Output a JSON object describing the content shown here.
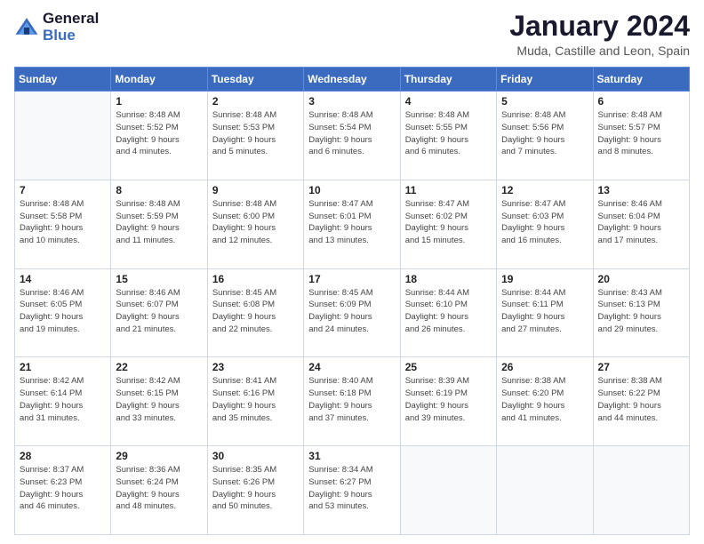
{
  "header": {
    "logo_line1": "General",
    "logo_line2": "Blue",
    "month_title": "January 2024",
    "location": "Muda, Castille and Leon, Spain"
  },
  "days_of_week": [
    "Sunday",
    "Monday",
    "Tuesday",
    "Wednesday",
    "Thursday",
    "Friday",
    "Saturday"
  ],
  "weeks": [
    [
      {
        "num": "",
        "detail": ""
      },
      {
        "num": "1",
        "detail": "Sunrise: 8:48 AM\nSunset: 5:52 PM\nDaylight: 9 hours\nand 4 minutes."
      },
      {
        "num": "2",
        "detail": "Sunrise: 8:48 AM\nSunset: 5:53 PM\nDaylight: 9 hours\nand 5 minutes."
      },
      {
        "num": "3",
        "detail": "Sunrise: 8:48 AM\nSunset: 5:54 PM\nDaylight: 9 hours\nand 6 minutes."
      },
      {
        "num": "4",
        "detail": "Sunrise: 8:48 AM\nSunset: 5:55 PM\nDaylight: 9 hours\nand 6 minutes."
      },
      {
        "num": "5",
        "detail": "Sunrise: 8:48 AM\nSunset: 5:56 PM\nDaylight: 9 hours\nand 7 minutes."
      },
      {
        "num": "6",
        "detail": "Sunrise: 8:48 AM\nSunset: 5:57 PM\nDaylight: 9 hours\nand 8 minutes."
      }
    ],
    [
      {
        "num": "7",
        "detail": "Sunrise: 8:48 AM\nSunset: 5:58 PM\nDaylight: 9 hours\nand 10 minutes."
      },
      {
        "num": "8",
        "detail": "Sunrise: 8:48 AM\nSunset: 5:59 PM\nDaylight: 9 hours\nand 11 minutes."
      },
      {
        "num": "9",
        "detail": "Sunrise: 8:48 AM\nSunset: 6:00 PM\nDaylight: 9 hours\nand 12 minutes."
      },
      {
        "num": "10",
        "detail": "Sunrise: 8:47 AM\nSunset: 6:01 PM\nDaylight: 9 hours\nand 13 minutes."
      },
      {
        "num": "11",
        "detail": "Sunrise: 8:47 AM\nSunset: 6:02 PM\nDaylight: 9 hours\nand 15 minutes."
      },
      {
        "num": "12",
        "detail": "Sunrise: 8:47 AM\nSunset: 6:03 PM\nDaylight: 9 hours\nand 16 minutes."
      },
      {
        "num": "13",
        "detail": "Sunrise: 8:46 AM\nSunset: 6:04 PM\nDaylight: 9 hours\nand 17 minutes."
      }
    ],
    [
      {
        "num": "14",
        "detail": "Sunrise: 8:46 AM\nSunset: 6:05 PM\nDaylight: 9 hours\nand 19 minutes."
      },
      {
        "num": "15",
        "detail": "Sunrise: 8:46 AM\nSunset: 6:07 PM\nDaylight: 9 hours\nand 21 minutes."
      },
      {
        "num": "16",
        "detail": "Sunrise: 8:45 AM\nSunset: 6:08 PM\nDaylight: 9 hours\nand 22 minutes."
      },
      {
        "num": "17",
        "detail": "Sunrise: 8:45 AM\nSunset: 6:09 PM\nDaylight: 9 hours\nand 24 minutes."
      },
      {
        "num": "18",
        "detail": "Sunrise: 8:44 AM\nSunset: 6:10 PM\nDaylight: 9 hours\nand 26 minutes."
      },
      {
        "num": "19",
        "detail": "Sunrise: 8:44 AM\nSunset: 6:11 PM\nDaylight: 9 hours\nand 27 minutes."
      },
      {
        "num": "20",
        "detail": "Sunrise: 8:43 AM\nSunset: 6:13 PM\nDaylight: 9 hours\nand 29 minutes."
      }
    ],
    [
      {
        "num": "21",
        "detail": "Sunrise: 8:42 AM\nSunset: 6:14 PM\nDaylight: 9 hours\nand 31 minutes."
      },
      {
        "num": "22",
        "detail": "Sunrise: 8:42 AM\nSunset: 6:15 PM\nDaylight: 9 hours\nand 33 minutes."
      },
      {
        "num": "23",
        "detail": "Sunrise: 8:41 AM\nSunset: 6:16 PM\nDaylight: 9 hours\nand 35 minutes."
      },
      {
        "num": "24",
        "detail": "Sunrise: 8:40 AM\nSunset: 6:18 PM\nDaylight: 9 hours\nand 37 minutes."
      },
      {
        "num": "25",
        "detail": "Sunrise: 8:39 AM\nSunset: 6:19 PM\nDaylight: 9 hours\nand 39 minutes."
      },
      {
        "num": "26",
        "detail": "Sunrise: 8:38 AM\nSunset: 6:20 PM\nDaylight: 9 hours\nand 41 minutes."
      },
      {
        "num": "27",
        "detail": "Sunrise: 8:38 AM\nSunset: 6:22 PM\nDaylight: 9 hours\nand 44 minutes."
      }
    ],
    [
      {
        "num": "28",
        "detail": "Sunrise: 8:37 AM\nSunset: 6:23 PM\nDaylight: 9 hours\nand 46 minutes."
      },
      {
        "num": "29",
        "detail": "Sunrise: 8:36 AM\nSunset: 6:24 PM\nDaylight: 9 hours\nand 48 minutes."
      },
      {
        "num": "30",
        "detail": "Sunrise: 8:35 AM\nSunset: 6:26 PM\nDaylight: 9 hours\nand 50 minutes."
      },
      {
        "num": "31",
        "detail": "Sunrise: 8:34 AM\nSunset: 6:27 PM\nDaylight: 9 hours\nand 53 minutes."
      },
      {
        "num": "",
        "detail": ""
      },
      {
        "num": "",
        "detail": ""
      },
      {
        "num": "",
        "detail": ""
      }
    ]
  ]
}
